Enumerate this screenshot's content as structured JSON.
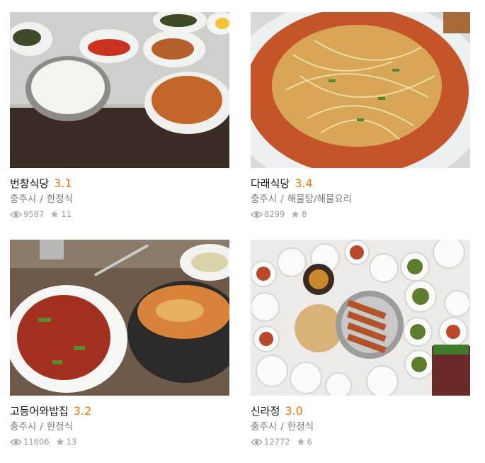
{
  "restaurants": [
    {
      "name": "번창식당",
      "rating": "3.1",
      "city": "충주시",
      "category": "한정식",
      "views": "9587",
      "reviews": "11"
    },
    {
      "name": "다래식당",
      "rating": "3.4",
      "city": "충주시",
      "category": "해물탕/해물요리",
      "views": "8299",
      "reviews": "8"
    },
    {
      "name": "고등어와밥집",
      "rating": "3.2",
      "city": "충주시",
      "category": "한정식",
      "views": "11606",
      "reviews": "13"
    },
    {
      "name": "신라정",
      "rating": "3.0",
      "city": "충주시",
      "category": "한정식",
      "views": "12772",
      "reviews": "6"
    }
  ],
  "icons": {
    "views": "eye-icon",
    "reviews": "star-icon"
  },
  "colors": {
    "rating": "#ff7100",
    "meta": "#7b7b7b",
    "icon": "#a8a8a8"
  }
}
